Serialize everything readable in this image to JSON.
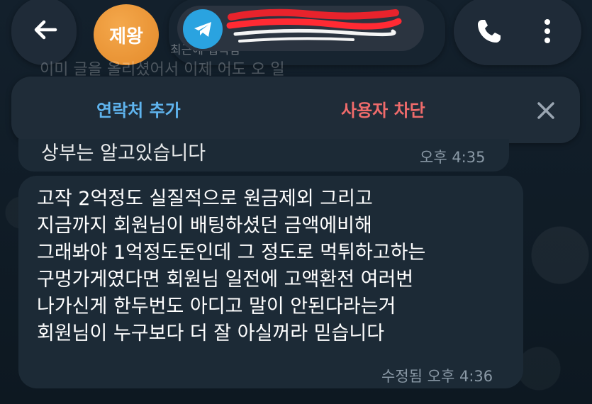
{
  "header": {
    "avatar_initials": "제왕",
    "contact_name": "",
    "status_text": "최근에 접속함",
    "background_line": "이미 글을 올리셨어서 이제 어도 오 일"
  },
  "banner": {
    "add_contact_label": "연락처 추가",
    "block_user_label": "사용자 차단"
  },
  "messages": [
    {
      "text": "상부는 알고있습니다",
      "time": "오후 4:35"
    },
    {
      "lines": [
        "고작 2억정도 실질적으로 원금제외 그리고",
        "지금까지 회원님이 배팅하셨던 금액에비해",
        "그래봐야 1억정도돈인데 그 정도로 먹튀하고하는",
        "구멍가게였다면 회원님 일전에 고액환전 여러번",
        "나가신게 한두번도 아디고 말이 안된다라는거",
        "회원님이 누구보다 더 잘 아실꺼라 믿습니다"
      ],
      "edited_label": "수정됨",
      "time": "오후 4:36"
    }
  ],
  "colors": {
    "accent_blue": "#5fb4ee",
    "danger_red": "#ef6b6b",
    "avatar_orange": "#f0a040",
    "telegram_blue": "#2aa3e0"
  },
  "icons": [
    "back-arrow-icon",
    "telegram-icon",
    "phone-icon",
    "more-vertical-icon",
    "close-icon"
  ]
}
